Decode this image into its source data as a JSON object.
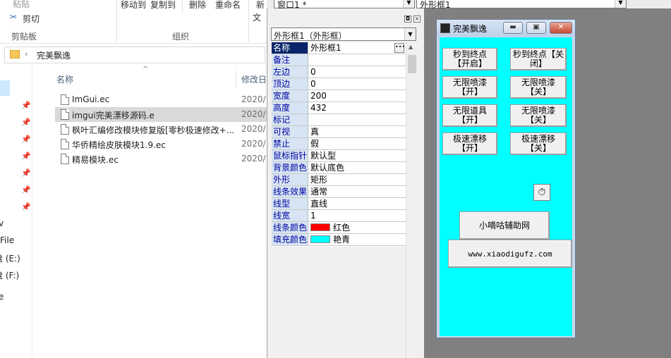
{
  "explorer": {
    "ribbon": {
      "paste_label": "粘贴",
      "cut_label": "剪切",
      "clipboard_group": "剪贴板",
      "move_to_label": "移动到",
      "copy_to_label": "复制到",
      "delete_label": "删除",
      "rename_label": "重命名",
      "new_label_top": "新",
      "new_label_bottom": "文",
      "organize_group": "组织"
    },
    "address": {
      "crumb": "完美飘逸"
    },
    "nav": {
      "items": [
        {
          "label": "v"
        },
        {
          "label": "File"
        },
        {
          "label": "盘 (E:)"
        },
        {
          "label": "盘 (F:)"
        },
        {
          "label": "e"
        }
      ]
    },
    "columns": {
      "name": "名称",
      "date": "修改日"
    },
    "files": [
      {
        "name": "ImGui.ec",
        "date": "2020/"
      },
      {
        "name": "imgui完美漂移源码.e",
        "date": "2020/"
      },
      {
        "name": "枫叶汇编修改模块修复版[零秒极速修改+...",
        "date": "2020/"
      },
      {
        "name": "华侨精绘皮肤模块1.9.ec",
        "date": "2020/"
      },
      {
        "name": "精易模块.ec",
        "date": "2020/"
      }
    ]
  },
  "toolbar": {
    "window_combo": "窗口1 *",
    "control_combo": "外形框1"
  },
  "property_panel": {
    "object_combo": "外形框1（外形框）",
    "rows": [
      {
        "name": "名称",
        "value": "外形框1",
        "selected": true
      },
      {
        "name": "备注",
        "value": ""
      },
      {
        "name": "左边",
        "value": "0"
      },
      {
        "name": "顶边",
        "value": "0"
      },
      {
        "name": "宽度",
        "value": "200"
      },
      {
        "name": "高度",
        "value": "432"
      },
      {
        "name": "标记",
        "value": ""
      },
      {
        "name": "可视",
        "value": "真"
      },
      {
        "name": "禁止",
        "value": "假"
      },
      {
        "name": "鼠标指针",
        "value": "默认型"
      },
      {
        "name": "背景颜色",
        "value": "默认底色"
      },
      {
        "name": "外形",
        "value": "矩形"
      },
      {
        "name": "线条效果",
        "value": "通常"
      },
      {
        "name": "线型",
        "value": "直线"
      },
      {
        "name": "线宽",
        "value": "1"
      },
      {
        "name": "线条颜色",
        "value": "红色",
        "swatch": "#ff0000"
      },
      {
        "name": "填充颜色",
        "value": "艳青",
        "swatch": "#00ffff"
      }
    ]
  },
  "designer": {
    "window_title": "完美飘逸",
    "client_color": "#00ffff",
    "buttons": [
      {
        "label": "秒到终点【开启】"
      },
      {
        "label": "秒到终点【关闭】"
      },
      {
        "label": "无限喷漆【开】"
      },
      {
        "label": "无限喷漆【关】"
      },
      {
        "label": "无限道具【开】"
      },
      {
        "label": "无限喷漆【关】"
      },
      {
        "label": "极速漂移【开】"
      },
      {
        "label": "极速漂移【关】"
      }
    ],
    "site_button": "小嘀咕辅助网",
    "url_button": "www.xiaodigufz.com"
  }
}
